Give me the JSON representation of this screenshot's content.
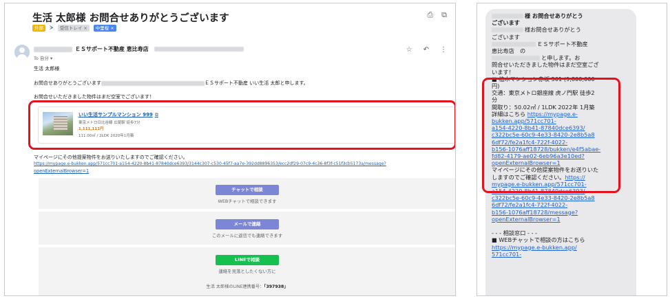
{
  "email": {
    "subject": "生活 太郎様 お問合せありがとうございます",
    "top_icons": [
      "print-icon",
      "open-in-new-window-icon"
    ],
    "labels": [
      {
        "text": "外部",
        "style": "orange",
        "removable": false
      },
      {
        "text": "受信トレイ",
        "style": "gray",
        "removable": true
      },
      {
        "text": "中里桜",
        "style": "blue",
        "removable": true
      }
    ],
    "label_remove_glyph": "×",
    "important_marker": "ᗒ",
    "sender_name": "ＥＳサポート不動産 恵比寿店",
    "recipient": "To 自分 ▾",
    "star_glyph": "☆",
    "reply_glyph": "↶",
    "more_glyph": "⋮",
    "greeting": "生活 太郎様",
    "intro_lead": "お問合せありがとうございます",
    "intro_tail": "ＥＳサポート不動産 いい生活 太郎と申します。",
    "availability": "お問合せいただきました物件はまだ空室でございます！",
    "property": {
      "name": "いい生活サンプルマンション 999",
      "station": "東京メトロ日比谷線 広尾駅 徒歩7分",
      "price": "1,111,111円",
      "details": "111.00㎡ / 2LDK 2020年1月築",
      "external_glyph": "⧉"
    },
    "mypage_intro": "マイページにその他提案物件をお送りいたしますのでご確認ください。",
    "mypage_link_line1": "https://mypage.e-bukken.app/571cc701-a154-4220-8b41-87840dce6393/3144c307-c530-45f7-aa7e-392dd8896353/ecc2df29-07c9-4c36-8f3f-c51f3cb5173a/message?",
    "mypage_link_line2": "openExternalBrowser=1",
    "chat": {
      "button": "チャットで相談",
      "sub": "WEBチャットで相談できます"
    },
    "mail": {
      "button": "メールで連絡",
      "sub": "このメールに返信でも連絡できます"
    },
    "line": {
      "button": "LINEで相談",
      "sub": "連絡を見落としたくない方に"
    },
    "line_id": {
      "label": "生活 太郎様のLINE連携番号：",
      "value": "「397938」"
    }
  },
  "sms": {
    "lines": [
      {
        "text": "様 お問合せありがとう",
        "style": "bold"
      },
      {
        "text": "ございます",
        "style": "bold"
      },
      {
        "text": "様お問合せありがとう",
        "style": "normal"
      },
      {
        "text": "ございます",
        "style": "normal"
      },
      {
        "text": "ＥＳサポート不動産",
        "style": "normal"
      },
      {
        "text": "恵比寿店　の",
        "style": "normal"
      },
      {
        "text": "と申します。お",
        "style": "normal"
      },
      {
        "text": "問合せいただきました物件はまだ空室ござ",
        "style": "normal"
      },
      {
        "text": "います！",
        "style": "normal"
      },
      {
        "text": "■ 植木マンション赤坂 501 (9,800,000",
        "style": "normal"
      },
      {
        "text": "円)",
        "style": "normal"
      },
      {
        "text": "交通：東京メトロ銀座線 虎ノ門駅 徒歩2",
        "style": "normal"
      },
      {
        "text": "分",
        "style": "normal"
      },
      {
        "text": "間取り：50.02㎡ / 1LDK 2022年 1月築",
        "style": "normal"
      },
      {
        "text": "詳細はこちら https://mypage.e-",
        "style": "link-tail"
      },
      {
        "text": "bukken.app/571cc701-",
        "style": "link"
      },
      {
        "text": "a154-4220-8b41-87840dce6393/",
        "style": "link"
      },
      {
        "text": "c322bc5e-60c9-4e33-8420-2e8b5a8",
        "style": "link"
      },
      {
        "text": "6df72/fe2a1fc4-722f-4022-",
        "style": "link"
      },
      {
        "text": "b156-1076aff18728/bukken/e4f5abae-",
        "style": "link"
      },
      {
        "text": "fd82-4179-ae02-6eb96a3e10ed?",
        "style": "link"
      },
      {
        "text": "openExternalBrowser=1",
        "style": "link"
      },
      {
        "text": "マイページにその他提案物件をお送りいた",
        "style": "normal"
      },
      {
        "text": "しますのでご確認ください。https://",
        "style": "link-tail"
      },
      {
        "text": "mypage.e-bukken.app/571cc701-",
        "style": "link"
      },
      {
        "text": "a154-4220-8b41-87840dce6393/",
        "style": "link"
      },
      {
        "text": "c322bc5e-60c9-4e33-8420-2e8b5a8",
        "style": "link"
      },
      {
        "text": "6df72/fe2a1fc4-722f-4022-",
        "style": "link"
      },
      {
        "text": "b156-1076aff18728/message?",
        "style": "link"
      },
      {
        "text": "openExternalBrowser=1",
        "style": "link"
      },
      {
        "text": "",
        "style": "normal"
      },
      {
        "text": "- - - 相談窓口 - - -",
        "style": "normal"
      },
      {
        "text": "■ WEBチャットで相談の方はこちら",
        "style": "normal"
      },
      {
        "text": "https://mypage.e-bukken.app/",
        "style": "link"
      },
      {
        "text": "571cc701-",
        "style": "link"
      }
    ]
  }
}
